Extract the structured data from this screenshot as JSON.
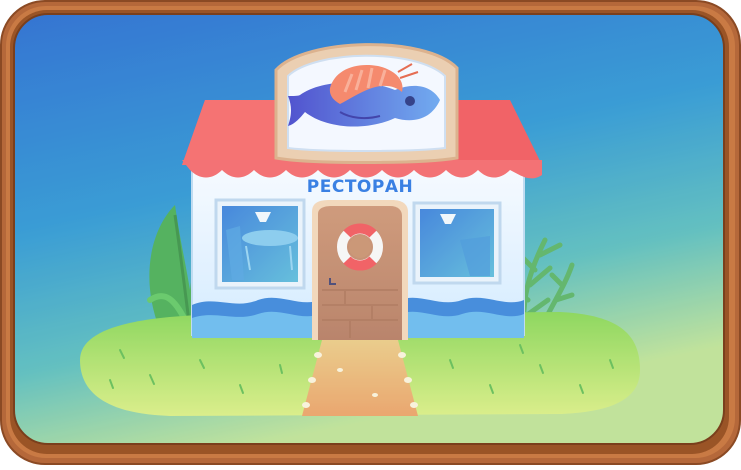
{
  "card": {
    "sign_text": "РЕСТОРАН"
  },
  "icons": {
    "fish": "fish-icon",
    "shrimp": "shrimp-icon",
    "lifebuoy": "lifebuoy-icon"
  },
  "colors": {
    "frame": "#b86a37",
    "sky_top": "#1b66cf",
    "sky_bottom": "#c9e78a",
    "roof": "#ef4e52",
    "sign_text": "#1f6fe0",
    "grass": "#8fd84f"
  }
}
